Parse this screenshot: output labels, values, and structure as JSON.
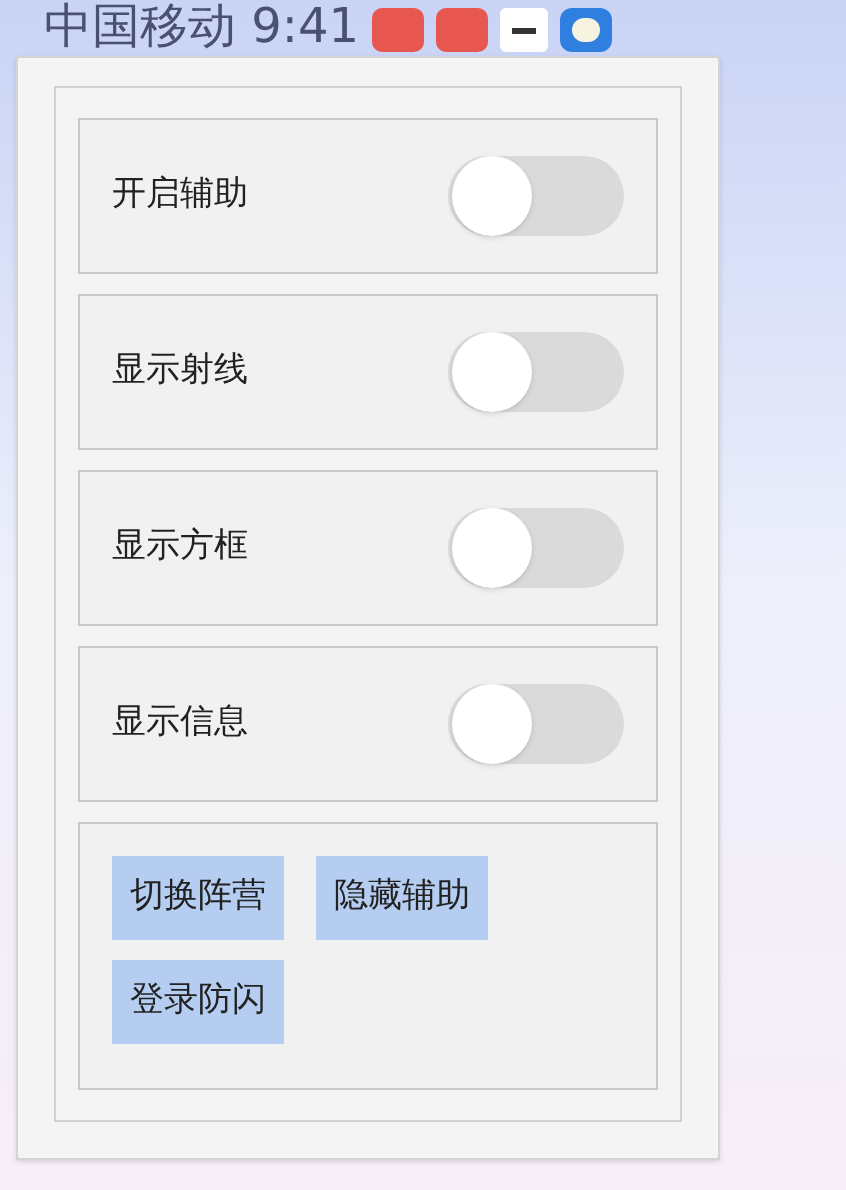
{
  "status_bar": {
    "carrier_time": "中国移动 9:41"
  },
  "toggles": [
    {
      "label": "开启辅助",
      "on": false
    },
    {
      "label": "显示射线",
      "on": false
    },
    {
      "label": "显示方框",
      "on": false
    },
    {
      "label": "显示信息",
      "on": false
    }
  ],
  "buttons": [
    "切换阵营",
    "隐藏辅助",
    "登录防闪"
  ]
}
